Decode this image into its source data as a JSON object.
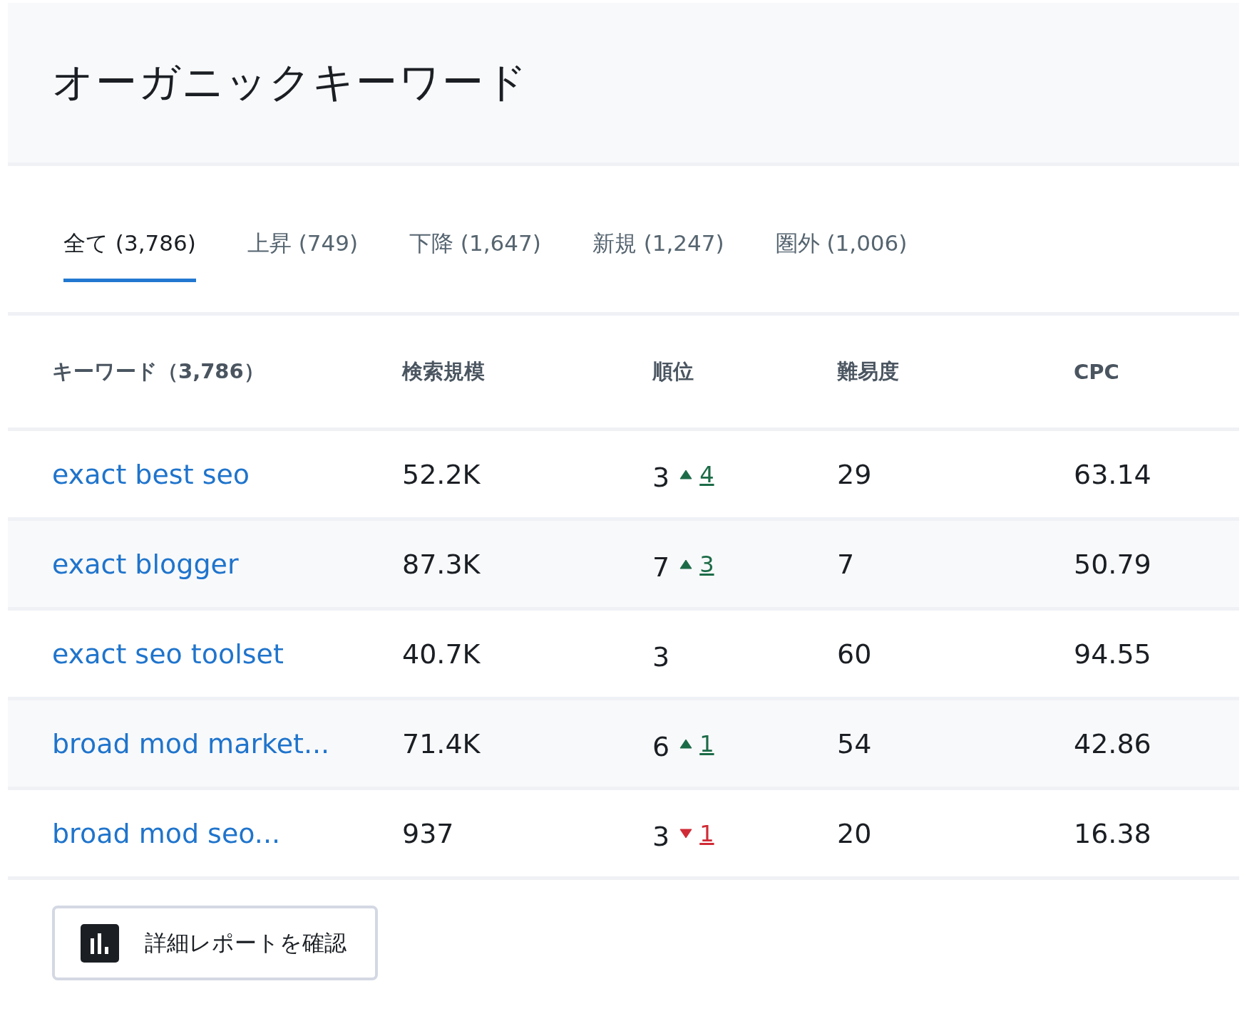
{
  "title": "オーガニックキーワード",
  "tabs": [
    {
      "label": "全て (3,786)",
      "selected": true
    },
    {
      "label": "上昇 (749)",
      "selected": false
    },
    {
      "label": "下降 (1,647)",
      "selected": false
    },
    {
      "label": "新規 (1,247)",
      "selected": false
    },
    {
      "label": "圏外 (1,006)",
      "selected": false
    }
  ],
  "table": {
    "columns": [
      "キーワード（3,786）",
      "検索規模",
      "順位",
      "難易度",
      "CPC"
    ],
    "rows": [
      {
        "keyword": "exact best seo",
        "volume": "52.2K",
        "rank": "3",
        "change": {
          "kind": "up",
          "value": "4"
        },
        "difficulty": "29",
        "cpc": "63.14"
      },
      {
        "keyword": "exact blogger",
        "volume": "87.3K",
        "rank": "7",
        "change": {
          "kind": "up",
          "value": "3"
        },
        "difficulty": "7",
        "cpc": "50.79"
      },
      {
        "keyword": "exact seo toolset",
        "volume": "40.7K",
        "rank": "3",
        "difficulty": "60",
        "cpc": "94.55"
      },
      {
        "keyword": "broad mod market...",
        "volume": "71.4K",
        "rank": "6",
        "change": {
          "kind": "up",
          "value": "1"
        },
        "difficulty": "54",
        "cpc": "42.86"
      },
      {
        "keyword": "broad mod seo...",
        "volume": "937",
        "rank": "3",
        "change": {
          "kind": "down",
          "value": "1"
        },
        "difficulty": "20",
        "cpc": "16.38"
      }
    ]
  },
  "report_button": {
    "label": "詳細レポートを確認"
  }
}
